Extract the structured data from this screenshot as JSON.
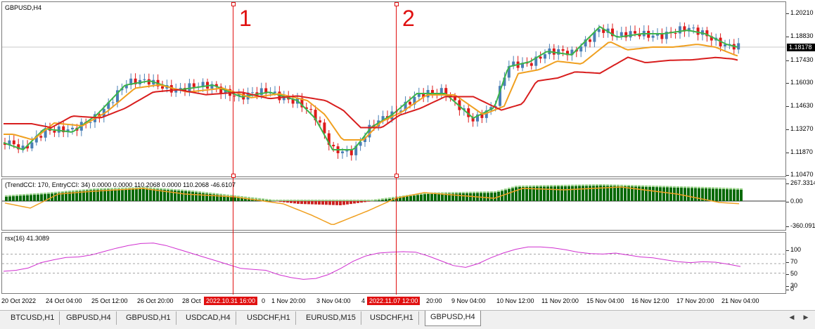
{
  "window": {
    "symbol_label": "GBPUSD,H4"
  },
  "main": {
    "price_ticks": [
      "1.20210",
      "1.18830",
      "1.17430",
      "1.16030",
      "1.14630",
      "1.13270",
      "1.11870",
      "1.10470"
    ],
    "current_price": "1.18178",
    "ma_colors": {
      "fast": "#3cb44b",
      "mid": "#f0a020",
      "slow": "#d81e1e"
    },
    "candle_colors": {
      "bull": "#4a7fb5",
      "bear": "#dd1a1a"
    }
  },
  "cci": {
    "label": "(TrendCCI: 170, EntryCCI: 34)  0.0000 0.0000 110.2068 0.0000 110.2068 -46.6107",
    "ticks": [
      "267.3314",
      "0.00",
      "-360.0911"
    ]
  },
  "rsx": {
    "label": "rsx(16) 41.3089",
    "ticks": [
      "100",
      "70",
      "50",
      "30",
      "0"
    ],
    "values": [
      34,
      36,
      41,
      52,
      58,
      63,
      64,
      68,
      75,
      82,
      88,
      92,
      93,
      88,
      80,
      72,
      64,
      56,
      48,
      40,
      38,
      36,
      27,
      21,
      17,
      19,
      27,
      40,
      55,
      66,
      72,
      74,
      75,
      74,
      66,
      56,
      46,
      42,
      50,
      62,
      72,
      80,
      85,
      85,
      83,
      79,
      74,
      71,
      70,
      72,
      68,
      64,
      62,
      58,
      54,
      52,
      54,
      53,
      49,
      44
    ]
  },
  "time_axis": {
    "labels": [
      "20 Oct 2022",
      "24 Oct 04:00",
      "25 Oct 12:00",
      "26 Oct 20:00",
      "28 Oct",
      "0",
      "1 Nov 20:00",
      "3 Nov 04:00",
      "4",
      "20:00",
      "9 Nov 04:00",
      "10 Nov 12:00",
      "11 Nov 20:00",
      "15 Nov 04:00",
      "16 Nov 12:00",
      "17 Nov 20:00",
      "21 Nov 04:00"
    ],
    "markers": [
      "2022.10.31 16:00",
      "2022.11.07 12:00"
    ]
  },
  "vlines": {
    "line1": "1",
    "line2": "2"
  },
  "tabs": [
    {
      "label": "BTCUSD,H1"
    },
    {
      "label": "GBPUSD,H4"
    },
    {
      "label": "GBPUSD,H1"
    },
    {
      "label": "USDCAD,H4"
    },
    {
      "label": "USDCHF,H1"
    },
    {
      "label": "EURUSD,M15"
    },
    {
      "label": "USDCHF,H1"
    },
    {
      "label": "GBPUSD,H4"
    }
  ]
}
